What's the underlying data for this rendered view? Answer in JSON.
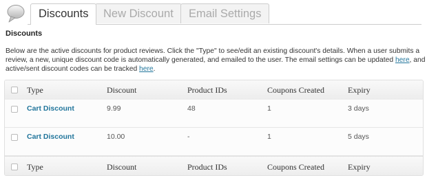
{
  "tabs": [
    {
      "label": "Discounts",
      "active": true
    },
    {
      "label": "New Discount",
      "active": false
    },
    {
      "label": "Email Settings",
      "active": false
    }
  ],
  "section_title": "Discounts",
  "description": {
    "text_1": "Below are the active discounts for product reviews. Click the \"Type\" to see/edit an existing discount's details. When a user submits a review, a new, unique discount code is automatically generated, and emailed to the user. The email settings can be updated ",
    "link_1": "here",
    "text_2": ", and active/sent discount codes can be tracked ",
    "link_2": "here",
    "text_3": "."
  },
  "table": {
    "columns": [
      "Type",
      "Discount",
      "Product IDs",
      "Coupons Created",
      "Expiry"
    ],
    "rows": [
      {
        "type": "Cart Discount",
        "discount": "9.99",
        "product_ids": "48",
        "coupons_created": "1",
        "expiry": "3 days"
      },
      {
        "type": "Cart Discount",
        "discount": "10.00",
        "product_ids": "-",
        "coupons_created": "1",
        "expiry": "5 days"
      }
    ]
  },
  "colors": {
    "link": "#21759b",
    "border": "#dfdfdf"
  }
}
